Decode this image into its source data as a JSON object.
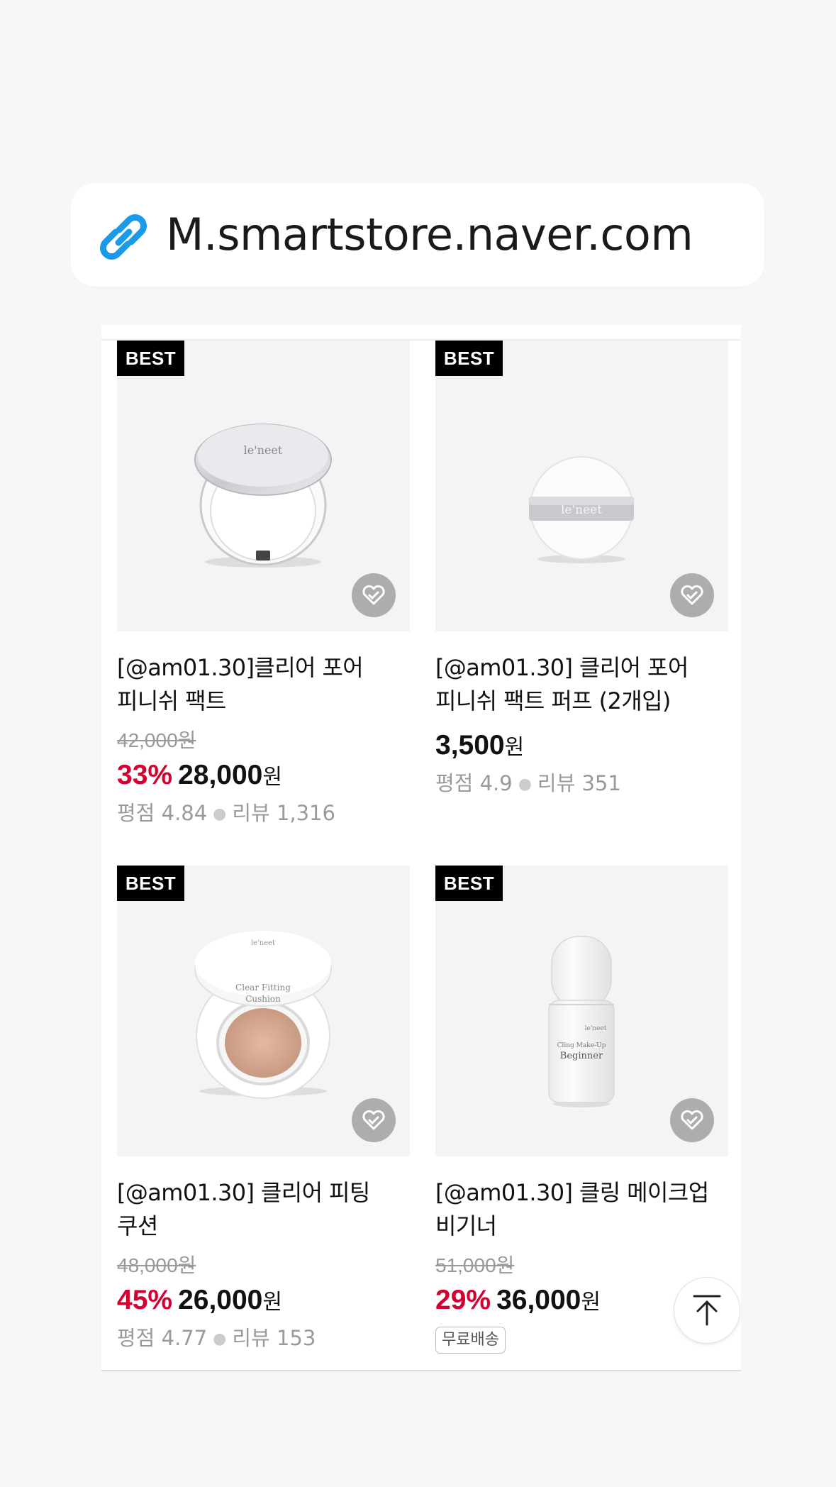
{
  "url_bar": {
    "icon": "link-icon",
    "text": "M.smartstore.naver.com"
  },
  "products": [
    {
      "badge": "BEST",
      "title_line1": "[@am01.30]클리어 포어",
      "title_line2": "피니쉬 팩트",
      "original_price": "42,000원",
      "discount": "33%",
      "price": "28,000",
      "currency": "원",
      "rating_label": "평점 4.84",
      "review_label": "리뷰 1,316"
    },
    {
      "badge": "BEST",
      "title_line1": "[@am01.30] 클리어 포어",
      "title_line2": "피니쉬 팩트 퍼프 (2개입)",
      "price": "3,500",
      "currency": "원",
      "rating_label": "평점 4.9",
      "review_label": "리뷰 351"
    },
    {
      "badge": "BEST",
      "title_line1": "[@am01.30] 클리어 피팅",
      "title_line2": "쿠션",
      "original_price": "48,000원",
      "discount": "45%",
      "price": "26,000",
      "currency": "원",
      "rating_label": "평점 4.77",
      "review_label": "리뷰 153"
    },
    {
      "badge": "BEST",
      "title_line1": "[@am01.30] 클링 메이크업",
      "title_line2": "비기너",
      "original_price": "51,000원",
      "discount": "29%",
      "price": "36,000",
      "currency": "원",
      "shipping_tag": "무료배송"
    }
  ],
  "product_art": {
    "brand_text": "le'neet",
    "cushion_text_1": "Clear Fitting",
    "cushion_text_2": "Cushion",
    "bottle_text_1": "Cling Make-Up",
    "bottle_text_2": "Beginner"
  },
  "colors": {
    "discount": "#d40030",
    "badge_bg": "#000000",
    "link_icon": "#1a9bea"
  },
  "scroll_top": {
    "icon": "arrow-up-to-top-icon"
  }
}
